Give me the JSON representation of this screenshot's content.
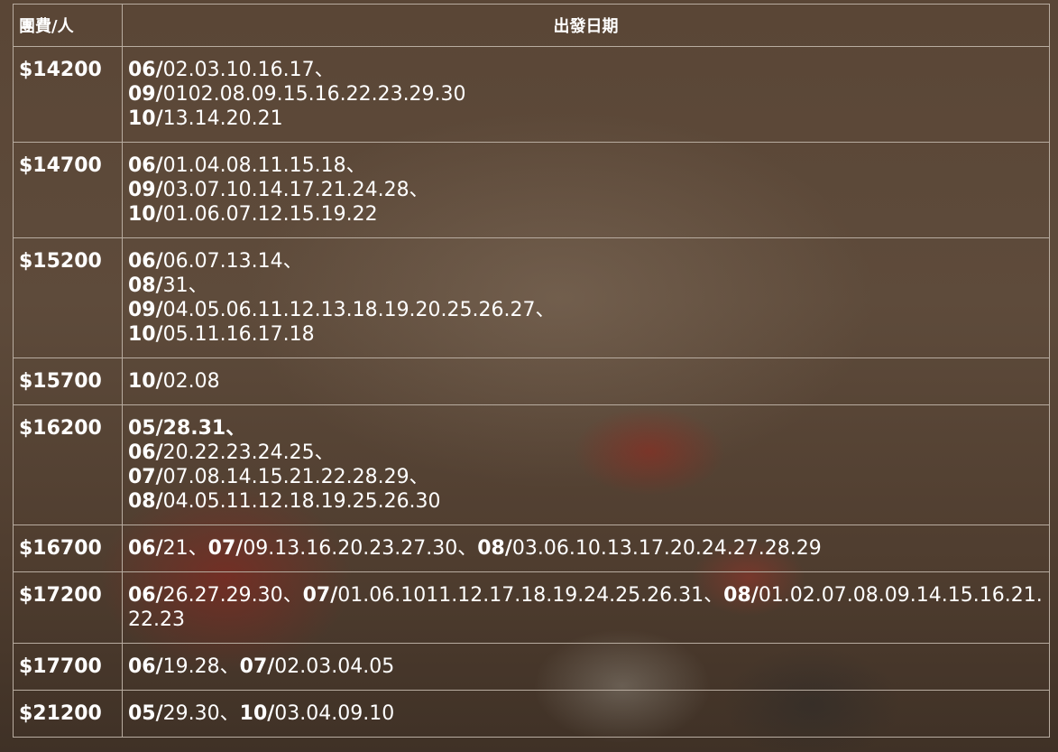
{
  "table": {
    "headers": {
      "price": "團費/人",
      "dates": "出發日期"
    },
    "rows": [
      {
        "price": "$14200",
        "lines": [
          [
            {
              "m": "06/",
              "d": "02.03.10.16.17、"
            }
          ],
          [
            {
              "m": "09/",
              "d": "0102.08.09.15.16.22.23.29.30"
            }
          ],
          [
            {
              "m": "10/",
              "d": "13.14.20.21"
            }
          ]
        ]
      },
      {
        "price": "$14700",
        "lines": [
          [
            {
              "m": "06/",
              "d": "01.04.08.11.15.18、"
            }
          ],
          [
            {
              "m": "09/",
              "d": "03.07.10.14.17.21.24.28、"
            }
          ],
          [
            {
              "m": "10/",
              "d": "01.06.07.12.15.19.22"
            }
          ]
        ]
      },
      {
        "price": "$15200",
        "lines": [
          [
            {
              "m": "06/",
              "d": "06.07.13.14、"
            }
          ],
          [
            {
              "m": "08/",
              "d": "31、"
            }
          ],
          [
            {
              "m": "09/",
              "d": "04.05.06.11.12.13.18.19.20.25.26.27、"
            }
          ],
          [
            {
              "m": "10/",
              "d": "05.11.16.17.18"
            }
          ]
        ]
      },
      {
        "price": "$15700",
        "lines": [
          [
            {
              "m": "10/",
              "d": "02.08"
            }
          ]
        ]
      },
      {
        "price": "$16200",
        "lines": [
          [
            {
              "m": "05/28.31、",
              "d": ""
            }
          ],
          [
            {
              "m": "06/",
              "d": "20.22.23.24.25、"
            }
          ],
          [
            {
              "m": "07/",
              "d": "07.08.14.15.21.22.28.29、"
            }
          ],
          [
            {
              "m": "08/",
              "d": "04.05.11.12.18.19.25.26.30"
            }
          ]
        ]
      },
      {
        "price": "$16700",
        "lines": [
          [
            {
              "m": "06/",
              "d": "21、"
            },
            {
              "m": "07/",
              "d": "09.13.16.20.23.27.30、"
            },
            {
              "m": "08/",
              "d": "03.06.10.13.17.20.24.27.28.29"
            }
          ]
        ]
      },
      {
        "price": "$17200",
        "lines": [
          [
            {
              "m": "06/",
              "d": "26.27.29.30、"
            },
            {
              "m": "07/",
              "d": "01.06.1011.12.17.18.19.24.25.26.31、"
            },
            {
              "m": "08/",
              "d": "01.02.07.08.09.14.15.16.21.22.23"
            }
          ]
        ]
      },
      {
        "price": "$17700",
        "lines": [
          [
            {
              "m": "06/",
              "d": "19.28、"
            },
            {
              "m": "07/",
              "d": "02.03.04.05"
            }
          ]
        ]
      },
      {
        "price": "$21200",
        "lines": [
          [
            {
              "m": "05/",
              "d": "29.30、"
            },
            {
              "m": "10/",
              "d": "03.04.09.10"
            }
          ]
        ]
      }
    ]
  }
}
